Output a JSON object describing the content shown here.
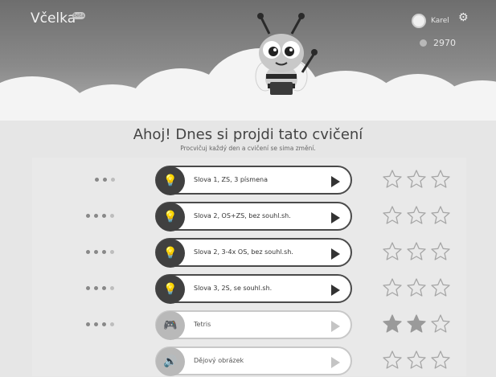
{
  "app": {
    "name": "Včelka",
    "badge": "beta"
  },
  "user": {
    "name": "Karel",
    "points": "2970"
  },
  "heading": {
    "title": "Ahoj! Dnes si projdi tato cvičení",
    "subtitle": "Procvičuj každý den a cvičení se sima změní."
  },
  "exercises": [
    {
      "label": "Slova 1, ZS, 3 písmena",
      "progress_dots": 3,
      "stars_earned": 0,
      "available": true,
      "icon": "lightbulb-icon"
    },
    {
      "label": "Slova 2, OS+ZS, bez souhl.sh.",
      "progress_dots": 4,
      "stars_earned": 0,
      "available": true,
      "icon": "lightbulb-icon"
    },
    {
      "label": "Slova 2, 3-4x OS, bez souhl.sh.",
      "progress_dots": 4,
      "stars_earned": 0,
      "available": true,
      "icon": "lightbulb-icon"
    },
    {
      "label": "Slova 3, 2S, se souhl.sh.",
      "progress_dots": 4,
      "stars_earned": 0,
      "available": true,
      "icon": "lightbulb-icon"
    },
    {
      "label": "Tetris",
      "progress_dots": 4,
      "stars_earned": 2,
      "available": false,
      "icon": "gamepad-icon"
    },
    {
      "label": "Dějový obrázek",
      "progress_dots": 0,
      "stars_earned": 0,
      "available": false,
      "icon": "speaker-icon"
    }
  ]
}
